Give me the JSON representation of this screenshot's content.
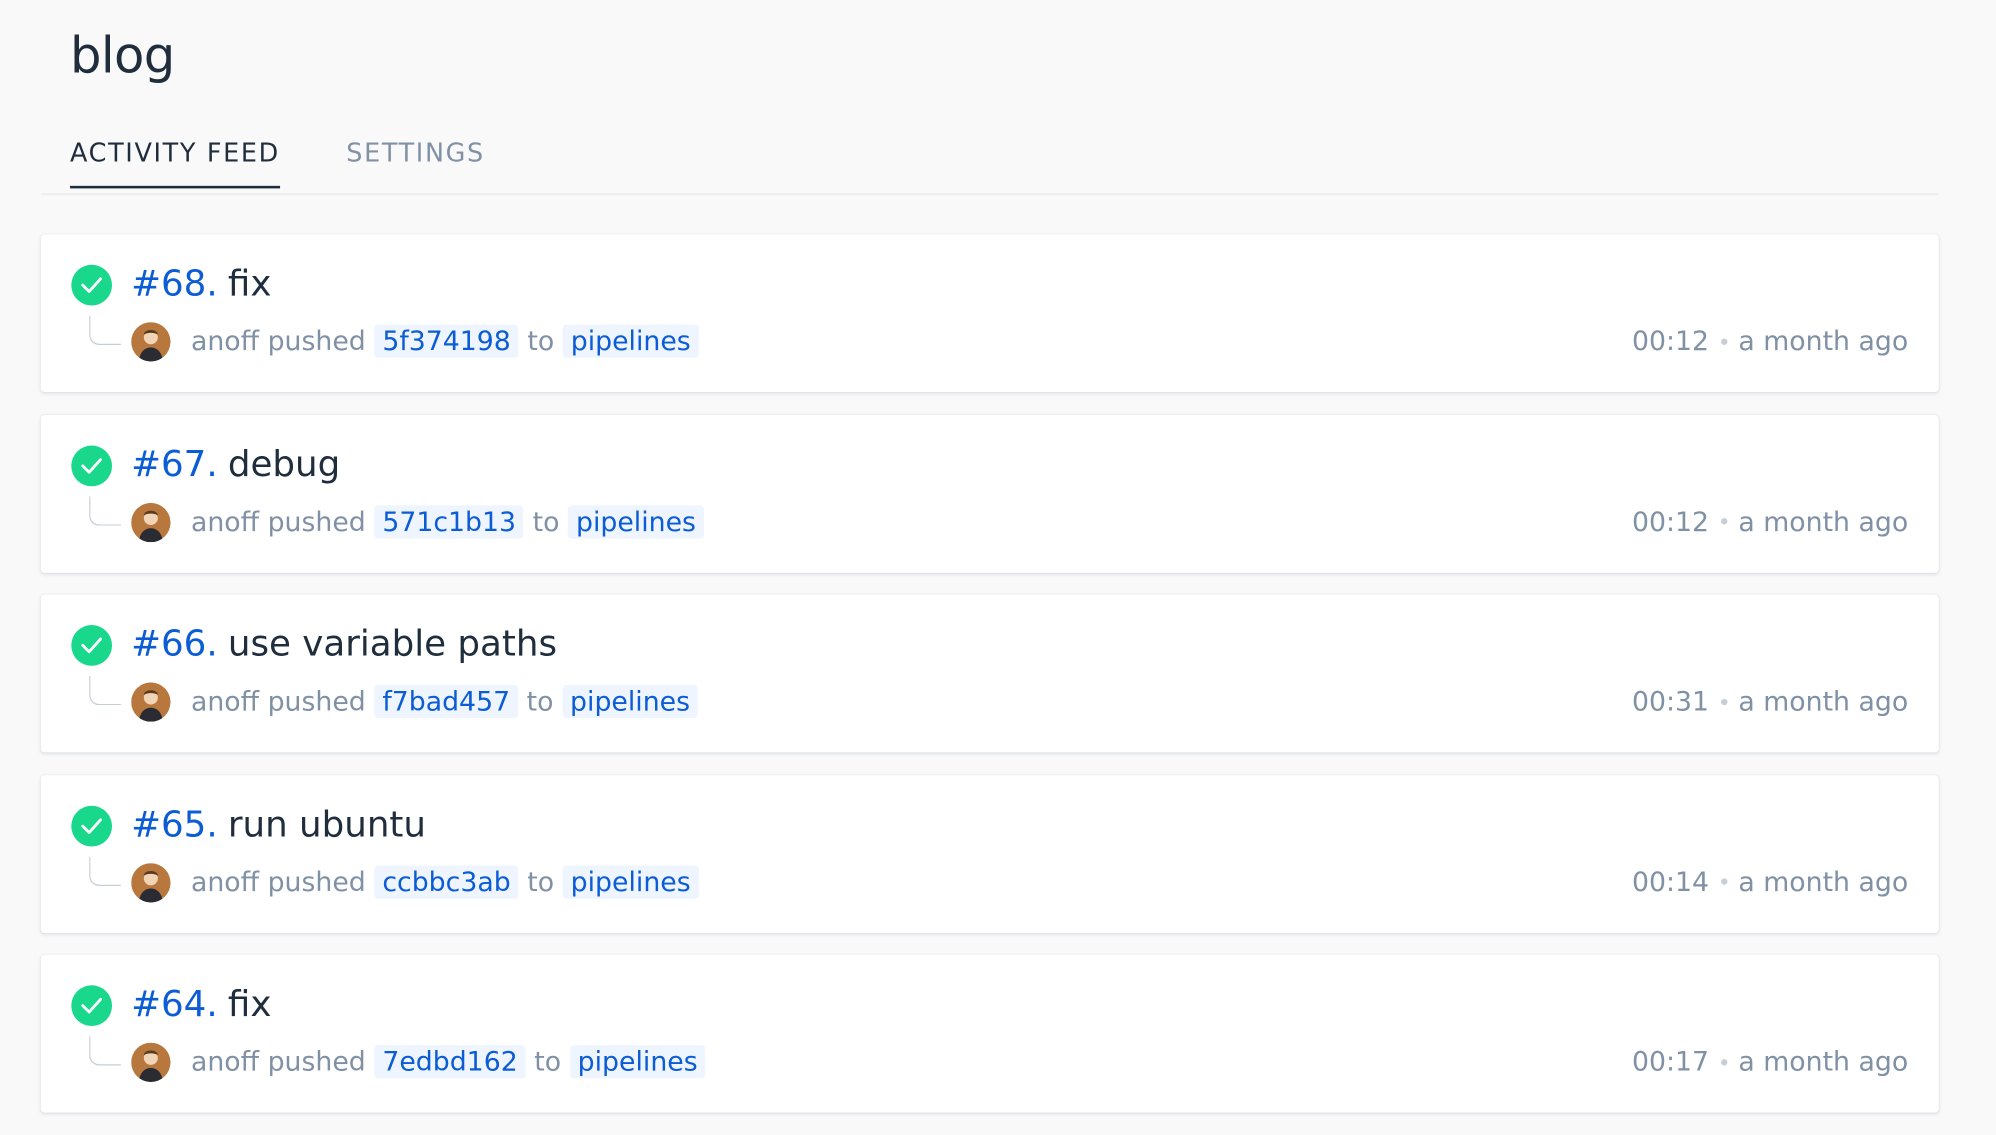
{
  "repo": {
    "name": "blog"
  },
  "tabs": [
    {
      "label": "ACTIVITY FEED",
      "active": true
    },
    {
      "label": "SETTINGS",
      "active": false
    }
  ],
  "builds": [
    {
      "number": "#68.",
      "message": "fix",
      "author": "anoff",
      "action": "pushed",
      "commit": "5f374198",
      "to": "to",
      "branch": "pipelines",
      "duration": "00:12",
      "when": "a month ago",
      "status": "success"
    },
    {
      "number": "#67.",
      "message": "debug",
      "author": "anoff",
      "action": "pushed",
      "commit": "571c1b13",
      "to": "to",
      "branch": "pipelines",
      "duration": "00:12",
      "when": "a month ago",
      "status": "success"
    },
    {
      "number": "#66.",
      "message": "use variable paths",
      "author": "anoff",
      "action": "pushed",
      "commit": "f7bad457",
      "to": "to",
      "branch": "pipelines",
      "duration": "00:31",
      "when": "a month ago",
      "status": "success"
    },
    {
      "number": "#65.",
      "message": "run ubuntu",
      "author": "anoff",
      "action": "pushed",
      "commit": "ccbbc3ab",
      "to": "to",
      "branch": "pipelines",
      "duration": "00:14",
      "when": "a month ago",
      "status": "success"
    },
    {
      "number": "#64.",
      "message": "fix",
      "author": "anoff",
      "action": "pushed",
      "commit": "7edbd162",
      "to": "to",
      "branch": "pipelines",
      "duration": "00:17",
      "when": "a month ago",
      "status": "success"
    }
  ],
  "colors": {
    "success": "#19d88c",
    "link": "#0b5cd5",
    "muted": "#8091a5",
    "text": "#1f2d3d"
  }
}
